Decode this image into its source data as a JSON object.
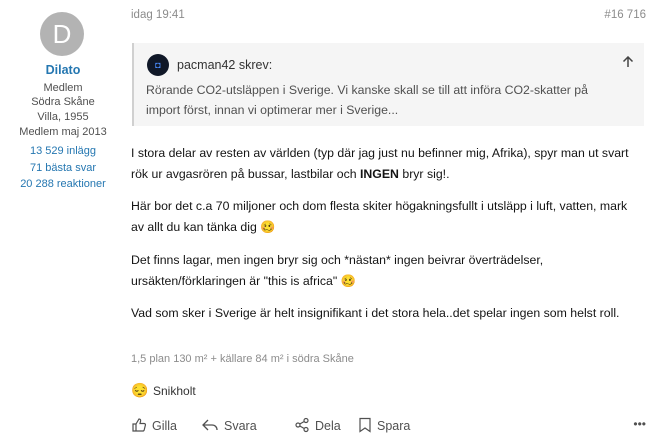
{
  "user": {
    "avatar_letter": "D",
    "name": "Dilato",
    "title": "Medlem",
    "region": "Södra Skåne",
    "home": "Villa, 1955",
    "member_since": "Medlem maj 2013",
    "posts": "13 529 inlägg",
    "best_answers": "71 bästa svar",
    "reactions": "20 288 reaktioner"
  },
  "post": {
    "date": "idag 19:41",
    "number": "#16 716",
    "quote": {
      "author": "pacman42 skrev:",
      "text": "Rörande CO2-utsläppen i Sverige. Vi kanske skall se till att införa CO2-skatter på import först, innan vi optimerar mer i Sverige..."
    },
    "paragraphs": [
      {
        "before": "I stora delar av resten av världen (typ där jag just nu befinner mig, Afrika), spyr man ut svart rök ur avgasrören på bussar, lastbilar och ",
        "bold": "INGEN",
        "after": " bryr sig!."
      },
      {
        "text": "Här bor det c.a 70 miljoner och dom flesta skiter högakningsfullt i utsläpp i luft, vatten, mark av allt du kan tänka dig",
        "emoji": "🥴"
      },
      {
        "text": "Det finns lagar, men ingen bryr sig och *nästan* ingen beivrar överträdelser, ursäkten/förklaringen är \"this is africa\"",
        "emoji": "🥴"
      },
      {
        "text": "Vad som sker i Sverige är helt insignifikant i det stora hela..det spelar ingen som helst roll."
      }
    ],
    "signature": "1,5 plan 130 m² + källare 84 m² i södra Skåne",
    "reaction": {
      "emoji": "😔",
      "by": "Snikholt"
    }
  },
  "actions": {
    "like": "Gilla",
    "reply": "Svara",
    "share": "Dela",
    "save": "Spara",
    "more": "•••"
  }
}
